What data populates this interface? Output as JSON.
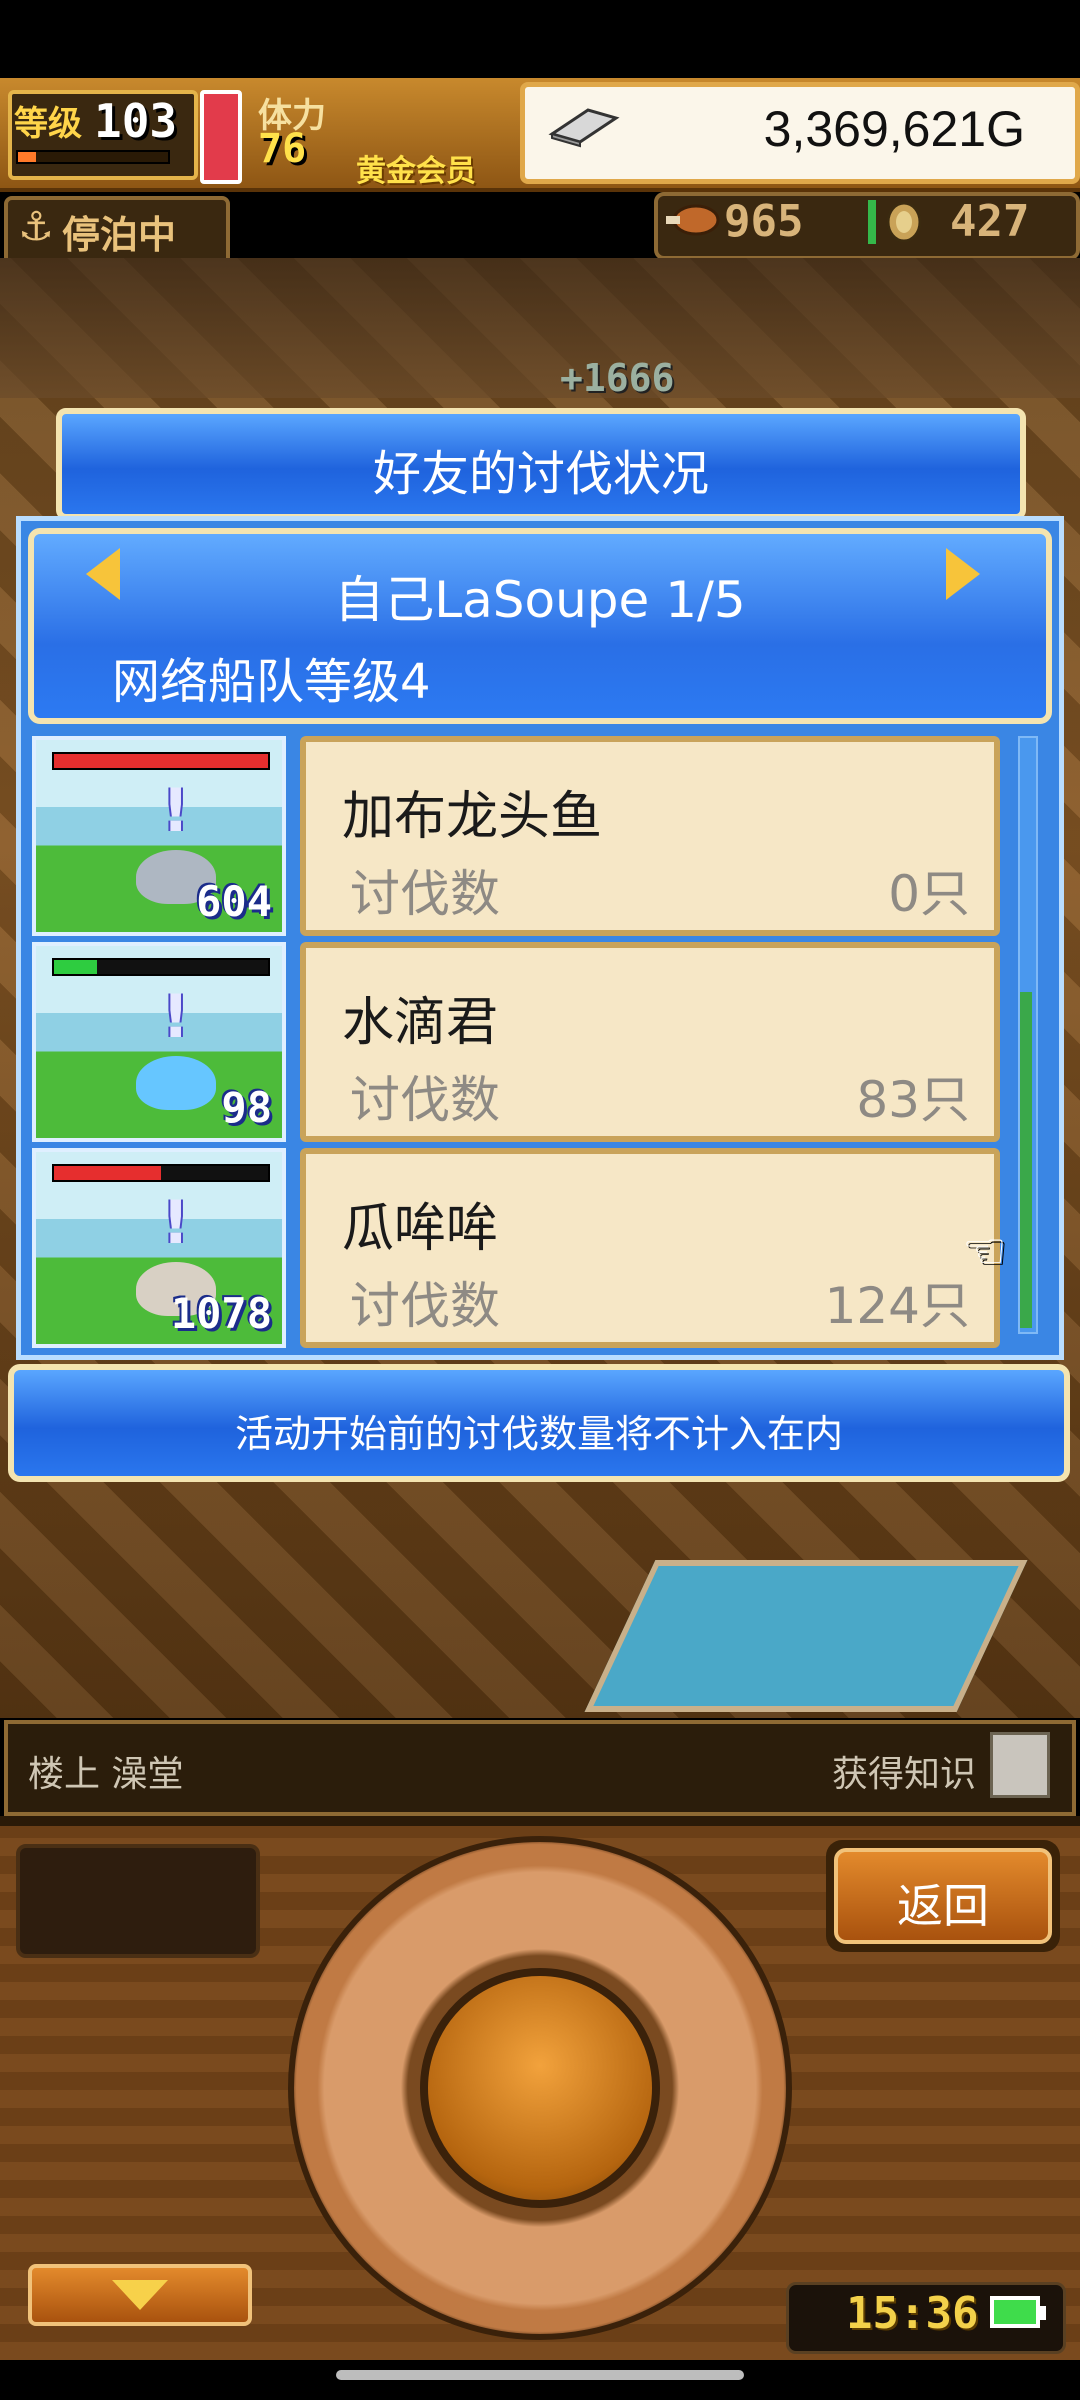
{
  "top_bar": {
    "level_label": "等级",
    "level_value": "103",
    "stamina_label": "体力",
    "stamina_value": "76",
    "membership": "黄金会员",
    "money": "3,369,621G",
    "moor_status": "停泊中",
    "food_value": "965",
    "medal_value": "427",
    "exp_fraction": 0.12
  },
  "map": {
    "floating_income": "+1666"
  },
  "dialog": {
    "title": "好友的讨伐状况",
    "player_name": "自己LaSoupe 1/5",
    "fleet_level": "网络船队等级4",
    "note": "活动开始前的讨伐数量将不计入在内",
    "monsters": [
      {
        "name": "加布龙头鱼",
        "kill_label": "讨伐数",
        "kill_value": "0只",
        "power": "604",
        "hp_fraction": 1.0,
        "hp_color": "#e62e2e"
      },
      {
        "name": "水滴君",
        "kill_label": "讨伐数",
        "kill_value": "83只",
        "power": "98",
        "hp_fraction": 0.2,
        "hp_color": "#2ecc40"
      },
      {
        "name": "瓜哞哞",
        "kill_label": "讨伐数",
        "kill_value": "124只",
        "power": "1078",
        "hp_fraction": 0.5,
        "hp_color": "#e62e2e"
      }
    ]
  },
  "location_strip": {
    "location": "楼上 澡堂",
    "knowledge": "获得知识"
  },
  "controller": {
    "back_label": "返回",
    "clock": "15:36"
  },
  "colors": {
    "dialog_blue": "#2a6fe6",
    "card_bg": "#f6e7c6",
    "gold": "#f7c43a"
  }
}
